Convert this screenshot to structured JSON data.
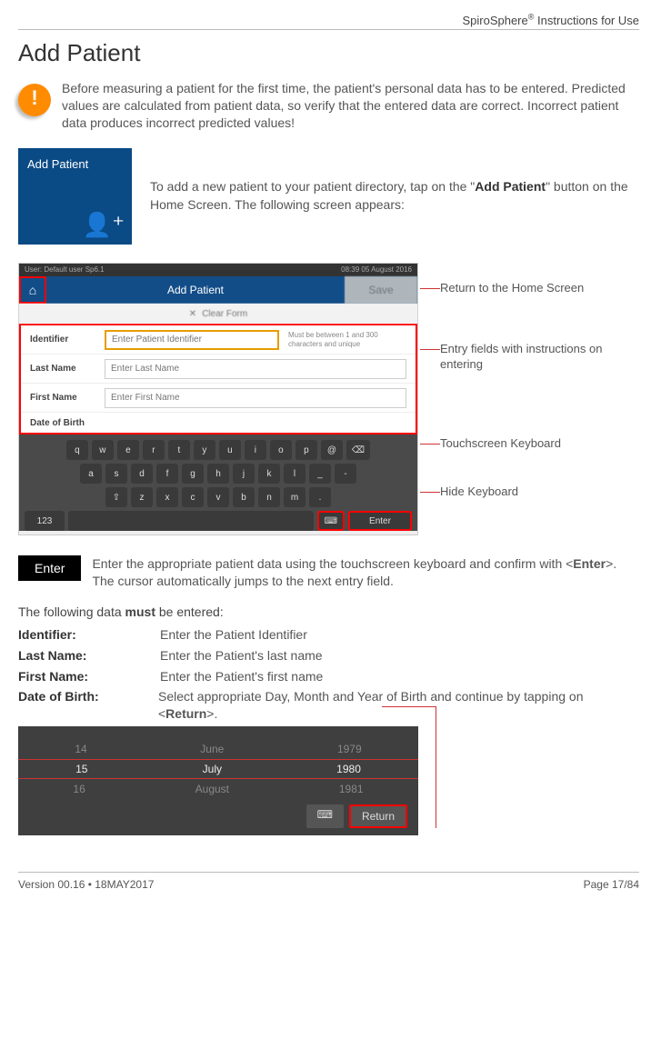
{
  "header": {
    "doc_title": "SpiroSphere® Instructions for Use"
  },
  "page_title": "Add Patient",
  "warning_text": "Before measuring a patient for the first time, the patient's personal data has to be entered. Predicted values are calculated from patient data, so verify that the entered data are correct. Incorrect patient data produces incorrect predicted values!",
  "tile": {
    "label": "Add Patient"
  },
  "tile_text_a": "To add a new patient to your patient directory, tap on the \"",
  "tile_text_bold": "Add Patient",
  "tile_text_b": "\" button on the Home Screen. The following screen appears:",
  "screenshot": {
    "status_left": "User: Default user Sp6.1",
    "status_right": "08:39 05 August 2016",
    "header_title": "Add Patient",
    "save_label": "Save",
    "clear_form_label": "Clear Form",
    "fields": {
      "identifier_lbl": "Identifier",
      "identifier_ph": "Enter Patient Identifier",
      "identifier_hint": "Must be between 1 and 300 characters and unique",
      "lastname_lbl": "Last Name",
      "lastname_ph": "Enter Last Name",
      "firstname_lbl": "First Name",
      "firstname_ph": "Enter First Name",
      "dob_lbl": "Date of Birth"
    },
    "kbd_rows": [
      [
        "q",
        "w",
        "e",
        "r",
        "t",
        "y",
        "u",
        "i",
        "o",
        "p",
        "@",
        "⌫"
      ],
      [
        "a",
        "s",
        "d",
        "f",
        "g",
        "h",
        "j",
        "k",
        "l",
        "_",
        "-"
      ],
      [
        "⇧",
        "z",
        "x",
        "c",
        "v",
        "b",
        "n",
        "m",
        ".",
        ""
      ],
      [
        "123",
        "",
        "",
        "",
        "",
        "Enter"
      ]
    ],
    "kbd_space_label": "",
    "kbd_hide_label": "⌨",
    "kbd_enter_label": "Enter",
    "kbd_123_label": "123"
  },
  "annotations": {
    "a1": "Return to the Home Screen",
    "a2": "Entry fields with instructions on entering",
    "a3": "Touchscreen Keyboard",
    "a4": "Hide Keyboard"
  },
  "enter_pill": "Enter",
  "enter_text_a": "Enter the appropriate patient data using the touchscreen keyboard and confirm with <",
  "enter_text_bold": "Enter",
  "enter_text_b": ">. The cursor automatically jumps to the next entry field.",
  "must_line_a": "The following data ",
  "must_line_bold": "must",
  "must_line_b": " be entered:",
  "data_fields": {
    "identifier": {
      "name": "Identifier:",
      "desc": "Enter the Patient Identifier"
    },
    "lastname": {
      "name": "Last Name:",
      "desc": "Enter the Patient's last name"
    },
    "firstname": {
      "name": "First Name:",
      "desc": "Enter the Patient's first name"
    },
    "dob_name": "Date of Birth:",
    "dob_desc_a": "Select appropriate Day, Month and Year of Birth and continue by tapping on <",
    "dob_desc_bold": "Return",
    "dob_desc_b": ">."
  },
  "dob_picker": {
    "r1": {
      "d": "14",
      "m": "June",
      "y": "1979"
    },
    "r2": {
      "d": "15",
      "m": "July",
      "y": "1980"
    },
    "r3": {
      "d": "16",
      "m": "August",
      "y": "1981"
    },
    "hide_label": "⌨",
    "return_label": "Return"
  },
  "footer": {
    "left": "Version 00.16 • 18MAY2017",
    "right": "Page 17/84"
  }
}
